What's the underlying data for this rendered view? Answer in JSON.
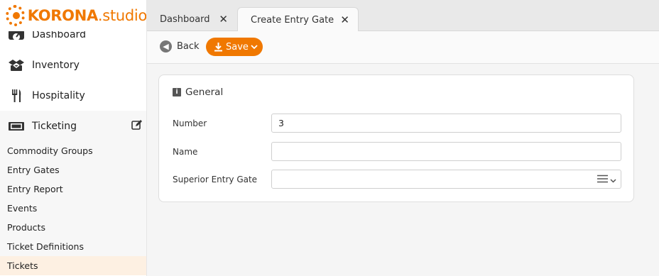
{
  "logo": {
    "brand": "KORONA",
    "suffix": ".studio"
  },
  "sidebar": {
    "main_items": [
      {
        "label": "Dashboard",
        "icon": "dashboard-icon"
      },
      {
        "label": "Inventory",
        "icon": "boxes-icon"
      },
      {
        "label": "Hospitality",
        "icon": "cutlery-icon"
      },
      {
        "label": "Ticketing",
        "icon": "ticket-icon",
        "action_icon": "edit-icon"
      }
    ],
    "sub_items": [
      {
        "label": "Commodity Groups"
      },
      {
        "label": "Entry Gates"
      },
      {
        "label": "Entry Report"
      },
      {
        "label": "Events"
      },
      {
        "label": "Products"
      },
      {
        "label": "Ticket Definitions"
      },
      {
        "label": "Tickets"
      }
    ]
  },
  "tabs": [
    {
      "label": "Dashboard",
      "close_icon": "close-icon"
    },
    {
      "label": "Create Entry Gate",
      "close_icon": "close-icon"
    }
  ],
  "toolbar": {
    "back_label": "Back",
    "save_label": "Save"
  },
  "form": {
    "section_title": "General",
    "fields": [
      {
        "label": "Number",
        "value": "3"
      },
      {
        "label": "Name",
        "value": ""
      },
      {
        "label": "Superior Entry Gate",
        "value": ""
      }
    ]
  },
  "colors": {
    "accent": "#f07800",
    "selected_bg": "#fdf0e2"
  }
}
